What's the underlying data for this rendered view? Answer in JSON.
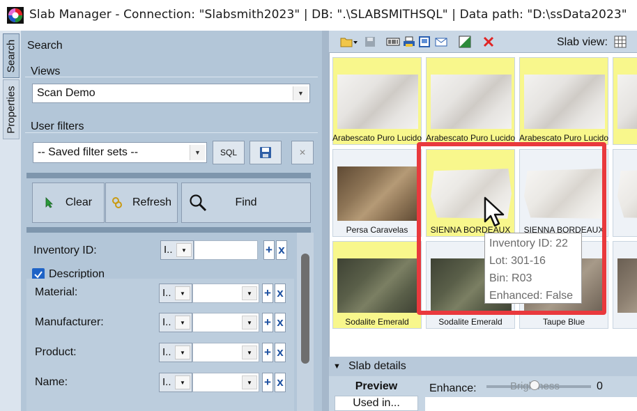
{
  "window": {
    "title": "Slab Manager -  Connection: \"Slabsmith2023\"  |  DB: \".\\SLABSMITHSQL\"  |  Data path: \"D:\\ssData2023\""
  },
  "vertical_tabs": [
    {
      "label": "Search",
      "active": true
    },
    {
      "label": "Properties",
      "active": false
    }
  ],
  "search_panel": {
    "heading": "Search",
    "views": {
      "label": "Views",
      "selected": "Scan Demo"
    },
    "user_filters": {
      "label": "User filters",
      "saved_sets_selected": "-- Saved filter sets --",
      "sql_button": "SQL",
      "save_icon": "save-icon",
      "delete_icon": "close-icon"
    },
    "actions": {
      "clear_label": "Clear",
      "refresh_label": "Refresh",
      "find_label": "Find"
    },
    "filters": [
      {
        "label": "Inventory ID:",
        "operator": "I..",
        "add": "+",
        "remove": "x"
      },
      {
        "label": "Description",
        "checked": true
      },
      {
        "label": "Material:",
        "operator": "I..",
        "add": "+",
        "remove": "x"
      },
      {
        "label": "Manufacturer:",
        "operator": "I..",
        "add": "+",
        "remove": "x"
      },
      {
        "label": "Product:",
        "operator": "I..",
        "add": "+",
        "remove": "x"
      },
      {
        "label": "Name:",
        "operator": "I..",
        "add": "+",
        "remove": "x"
      }
    ]
  },
  "toolbar": {
    "slab_view_label": "Slab view:",
    "icons": [
      "folder-open-icon",
      "save-icon",
      "barcode-icon",
      "print-label-icon",
      "scan-icon",
      "email-icon",
      "enhance-icon",
      "delete-icon",
      "grid-view-icon"
    ]
  },
  "slab_grid": {
    "tiles": [
      {
        "caption": "Arabescato Puro Lucido",
        "selected": true,
        "stone": "white-marble"
      },
      {
        "caption": "Arabescato Puro Lucido",
        "selected": true,
        "stone": "white-marble"
      },
      {
        "caption": "Arabescato Puro Lucido",
        "selected": true,
        "stone": "white-marble"
      },
      {
        "caption": "",
        "selected": true,
        "stone": "white-marble"
      },
      {
        "caption": "Persa Caravelas",
        "selected": false,
        "stone": "brown-granite"
      },
      {
        "caption": "SIENNA BORDEAUX",
        "selected": true,
        "stone": "light-marble"
      },
      {
        "caption": "SIENNA BORDEAUX",
        "selected": false,
        "stone": "light-marble"
      },
      {
        "caption": "SIENN",
        "selected": false,
        "stone": "light-marble"
      },
      {
        "caption": "Sodalite Emerald",
        "selected": true,
        "stone": "dark-green"
      },
      {
        "caption": "Sodalite Emerald",
        "selected": false,
        "stone": "dark-green"
      },
      {
        "caption": "Taupe Blue",
        "selected": false,
        "stone": "taupe"
      },
      {
        "caption": "T",
        "selected": false,
        "stone": "taupe"
      }
    ],
    "tooltip": {
      "inventory_id": "Inventory ID: 22",
      "lot": "Lot: 301-16",
      "bin": "Bin: R03",
      "enhanced": "Enhanced: False"
    }
  },
  "slab_details": {
    "title": "Slab details",
    "tabs": [
      "Preview",
      "Used in..."
    ],
    "enhance_label": "Enhance:",
    "brightness_label": "Brightness",
    "brightness_value": "0"
  },
  "colors": {
    "panel_bg": "#b3c6d8",
    "selected_tile": "#f8f78c",
    "highlight": "#e9393d",
    "toolbar_bg": "#c9d7e5"
  }
}
